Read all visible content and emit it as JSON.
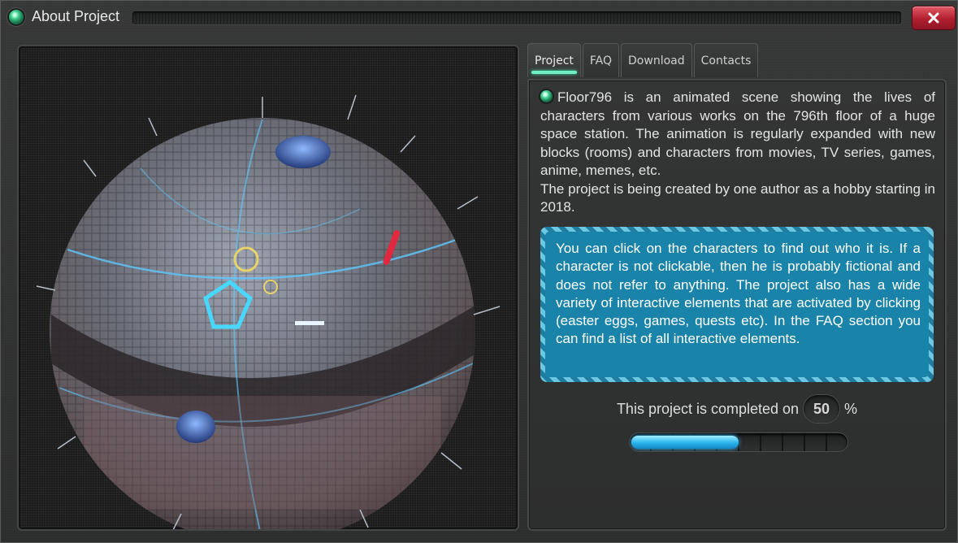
{
  "window": {
    "title": "About Project",
    "close_icon": "close-x-icon",
    "status_led_color": "#3fd08e",
    "close_color": "#b21f2f"
  },
  "tabs": [
    {
      "label": "Project",
      "active": true
    },
    {
      "label": "FAQ",
      "active": false
    },
    {
      "label": "Download",
      "active": false
    },
    {
      "label": "Contacts",
      "active": false
    }
  ],
  "project": {
    "intro": "Floor796 is an animated scene showing the lives of characters from various works on the 796th floor of a huge space station. The animation is regularly expanded with new blocks (rooms) and characters from movies, TV series, games, anime, memes, etc.",
    "intro_icon": "green-led-icon",
    "author_note": "The project is being created by one author as a hobby starting in 2018.",
    "notice": "You can click on the characters to find out who it is. If a character is not clickable, then he is probably fictional and does not refer to anything. The project also has a wide variety of interactive elements that are activated by clicking (easter eggs, games, quests etc). In the FAQ section you can find a list of all interactive elements.",
    "notice_color": "#1a83a9",
    "completion_label": "This project is completed on",
    "completion_value": "50",
    "completion_unit": "%",
    "completion_fraction": 0.5,
    "progress_color": "#2ab4ec"
  },
  "image": {
    "subject": "space-station-sphere-illustration"
  }
}
